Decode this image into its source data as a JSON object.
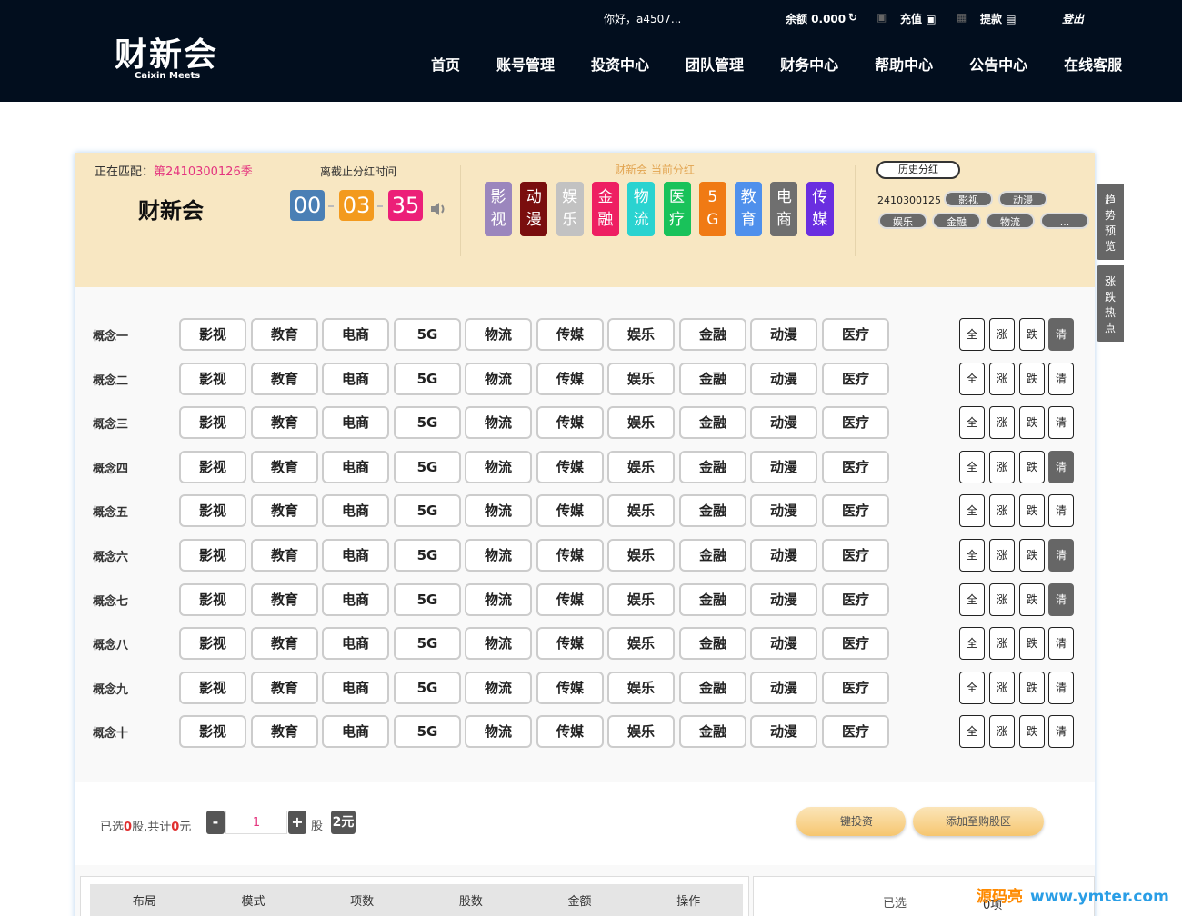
{
  "header": {
    "logo_cn": "财新会",
    "logo_en": "Caixin Meets",
    "greeting": "你好，a4507...",
    "balance": "余额 0.000",
    "recharge": "充值",
    "withdraw": "提款",
    "logout": "登出",
    "nav": [
      "首页",
      "账号管理",
      "投资中心",
      "团队管理",
      "财务中心",
      "帮助中心",
      "公告中心",
      "在线客服"
    ]
  },
  "info": {
    "matching_label": "正在匹配：",
    "season": "第2410300126季",
    "brand": "财新会",
    "countdown_label": "离截止分红时间",
    "countdown": {
      "h": "00",
      "m": "03",
      "s": "35"
    },
    "current_label": "财新会 当前分红",
    "categories": [
      {
        "text": "影视",
        "color": "#9b86bd"
      },
      {
        "text": "动漫",
        "color": "#7a0e0e"
      },
      {
        "text": "娱乐",
        "color": "#c2c2c2"
      },
      {
        "text": "金融",
        "color": "#ee1f62"
      },
      {
        "text": "物流",
        "color": "#2ad3d0"
      },
      {
        "text": "医疗",
        "color": "#19c25a"
      },
      {
        "text": "5G",
        "color": "#f07a14"
      },
      {
        "text": "教育",
        "color": "#4f90ec"
      },
      {
        "text": "电商",
        "color": "#6f6f6f"
      },
      {
        "text": "传媒",
        "color": "#6a2ee0"
      }
    ],
    "history_button": "历史分红",
    "history_id": "2410300125",
    "history_pills": [
      "影视",
      "动漫",
      "娱乐",
      "金融",
      "物流",
      "..."
    ]
  },
  "concepts": {
    "tags": [
      "影视",
      "教育",
      "电商",
      "5G",
      "物流",
      "传媒",
      "娱乐",
      "金融",
      "动漫",
      "医疗"
    ],
    "controls": [
      "全",
      "涨",
      "跌",
      "清"
    ],
    "rows": [
      {
        "label": "概念一",
        "clear_active": true
      },
      {
        "label": "概念二",
        "clear_active": false
      },
      {
        "label": "概念三",
        "clear_active": false
      },
      {
        "label": "概念四",
        "clear_active": true
      },
      {
        "label": "概念五",
        "clear_active": false
      },
      {
        "label": "概念六",
        "clear_active": true
      },
      {
        "label": "概念七",
        "clear_active": true
      },
      {
        "label": "概念八",
        "clear_active": false
      },
      {
        "label": "概念九",
        "clear_active": false
      },
      {
        "label": "概念十",
        "clear_active": false
      }
    ]
  },
  "order": {
    "selected_prefix": "已选",
    "selected_count": "0",
    "selected_mid": "股,共计",
    "selected_amount": "0",
    "selected_suffix": "元",
    "minus": "-",
    "quantity": "1",
    "plus": "+",
    "unit": "股",
    "price": "2元",
    "invest_button": "一键投资",
    "cart_button": "添加至购股区"
  },
  "table": {
    "headers": [
      "布局",
      "模式",
      "项数",
      "股数",
      "金额",
      "操作"
    ],
    "selected_title": "已选",
    "selected_count": "0项"
  },
  "side_tabs": [
    "趋势预览",
    "涨跌热点"
  ],
  "watermark": {
    "cn": "源码亮",
    "url": "www.ymter.com"
  }
}
